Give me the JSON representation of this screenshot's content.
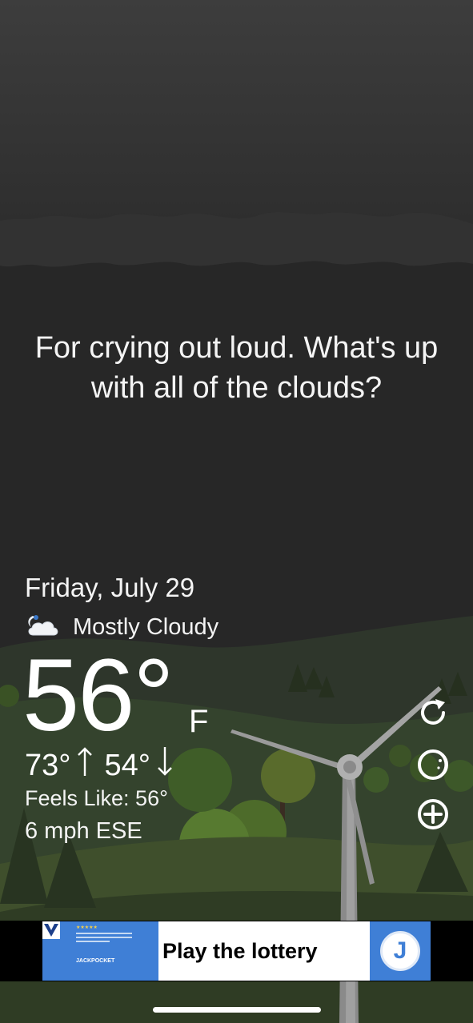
{
  "message": "For crying out loud. What's up with all of the clouds?",
  "weather": {
    "date": "Friday, July 29",
    "condition": "Mostly Cloudy",
    "condition_icon": "partly-cloudy-night-icon",
    "temperature": "56°",
    "unit": "F",
    "high": "73°",
    "low": "54°",
    "feels_like": "Feels Like: 56°",
    "wind": "6 mph ESE"
  },
  "actions": {
    "refresh_icon": "refresh-icon",
    "theme_icon": "moon-theme-icon",
    "add_icon": "add-location-icon"
  },
  "ad": {
    "cta": "Play the lottery",
    "brand": "JACKPOCKET",
    "badge": "J"
  },
  "colors": {
    "sky_top": "#3a3a3a",
    "sky_bottom": "#272727",
    "hill_dark": "#2b3a26",
    "hill_mid": "#3a4a2e",
    "ad_blue": "#3f7fd6"
  }
}
